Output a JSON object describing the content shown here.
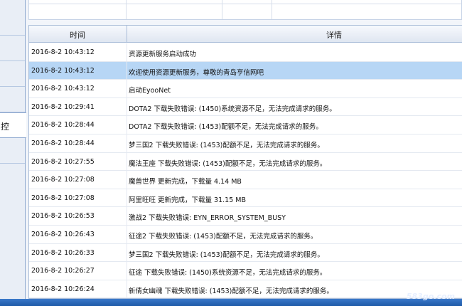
{
  "sidebar": {
    "active_label": "控"
  },
  "log_table": {
    "headers": {
      "time": "时间",
      "detail": "详情"
    },
    "selected_index": 1,
    "rows": [
      {
        "time": "2016-8-2 10:43:12",
        "detail": "资源更新服务启动成功"
      },
      {
        "time": "2016-8-2 10:43:12",
        "detail": "欢迎使用资源更新服务，尊敬的青岛亨信网吧"
      },
      {
        "time": "2016-8-2 10:43:12",
        "detail": "启动EyooNet"
      },
      {
        "time": "2016-8-2 10:29:41",
        "detail": "DOTA2 下载失败错误: (1450)系统资源不足，无法完成请求的服务。"
      },
      {
        "time": "2016-8-2 10:28:44",
        "detail": "DOTA2 下载失败错误: (1453)配额不足，无法完成请求的服务。"
      },
      {
        "time": "2016-8-2 10:28:44",
        "detail": "梦三国2 下载失败错误: (1453)配额不足，无法完成请求的服务。"
      },
      {
        "time": "2016-8-2 10:27:55",
        "detail": "魔法王座 下载失败错误: (1453)配额不足，无法完成请求的服务。"
      },
      {
        "time": "2016-8-2 10:27:08",
        "detail": "魔兽世界 更新完成，下载量 4.14 MB"
      },
      {
        "time": "2016-8-2 10:27:08",
        "detail": "阿里旺旺 更新完成，下载量 31.15 MB"
      },
      {
        "time": "2016-8-2 10:26:53",
        "detail": "激战2 下载失败错误: EYN_ERROR_SYSTEM_BUSY"
      },
      {
        "time": "2016-8-2 10:26:43",
        "detail": "征途2 下载失败错误: (1453)配额不足，无法完成请求的服务。"
      },
      {
        "time": "2016-8-2 10:26:33",
        "detail": "梦三国2 下载失败错误: (1453)配额不足，无法完成请求的服务。"
      },
      {
        "time": "2016-8-2 10:26:27",
        "detail": "征途 下载失败错误: (1450)系统资源不足，无法完成请求的服务。"
      },
      {
        "time": "2016-8-2 10:26:24",
        "detail": "新倩女幽魂 下载失败错误: (1453)配额不足，无法完成请求的服务。"
      }
    ]
  },
  "watermark": {
    "text": "583go.com"
  }
}
